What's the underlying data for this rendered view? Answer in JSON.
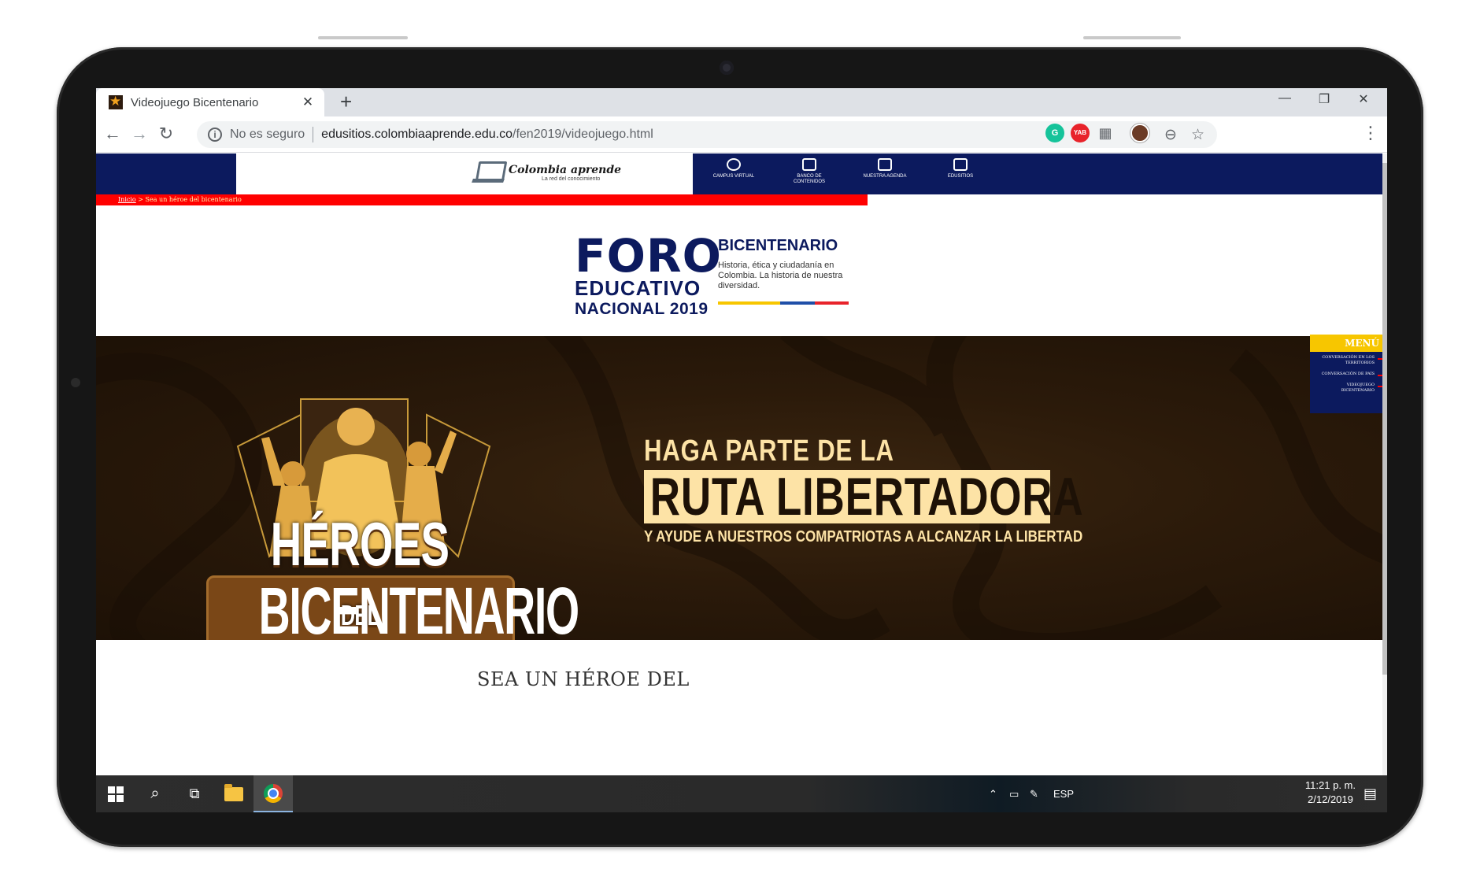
{
  "browser": {
    "tab_title": "Videojuego Bicentenario",
    "tab_close": "✕",
    "new_tab": "+",
    "security_label": "No es seguro",
    "url_host": "edusitios.colombiaaprende.edu.co",
    "url_path": "/fen2019/videojuego.html",
    "window_controls": [
      "—",
      "❐",
      "✕"
    ],
    "extensions": [
      {
        "name": "grammarly-icon",
        "color": "#15c39a",
        "label": "G"
      },
      {
        "name": "ad-extension-icon",
        "color": "#e8232b",
        "label": "YAB"
      },
      {
        "name": "grid-extension-icon",
        "color": "#5f6368",
        "label": "▦"
      }
    ]
  },
  "site": {
    "logo_name": "Colombia aprende",
    "logo_tagline": "La red del conocimiento",
    "nav": [
      {
        "label": "Campus virtual",
        "icon": "campus-icon"
      },
      {
        "label": "Banco de contenidos",
        "icon": "book-icon"
      },
      {
        "label": "Nuestra agenda",
        "icon": "calendar-icon"
      },
      {
        "label": "Edusitios",
        "icon": "edusitios-icon"
      }
    ],
    "breadcrumb_home": "Inicio",
    "breadcrumb_current": " > Sea un héroe del bicentenario",
    "foro": {
      "line1": "FORO",
      "line2": "EDUCATIVO",
      "line3": "NACIONAL 2019",
      "bicentenario": "BICENTENARIO",
      "description": "Historia, ética y ciudadanía en Colombia. La historia de nuestra diversidad.",
      "flag_colors": [
        "#f7c600",
        "#1f4fa8",
        "#e8232b"
      ]
    },
    "hero": {
      "game_title_1": "HÉROES",
      "game_title_del": "DEL",
      "game_title_2": "BICENTENARIO",
      "cta_line1": "HAGA PARTE DE LA",
      "cta_line2": "RUTA LIBERTADORA",
      "cta_line3": "Y AYUDE A NUESTROS COMPATRIOTAS A ALCANZAR LA LIBERTAD"
    },
    "side_menu": {
      "title": "MENÚ",
      "items": [
        "Conversación en los territorios",
        "Conversación de país",
        "Videojuego bicentenario"
      ]
    },
    "section_title": "SEA UN HÉROE DEL"
  },
  "taskbar": {
    "language": "ESP",
    "time": "11:21 p. m.",
    "date": "2/12/2019"
  }
}
